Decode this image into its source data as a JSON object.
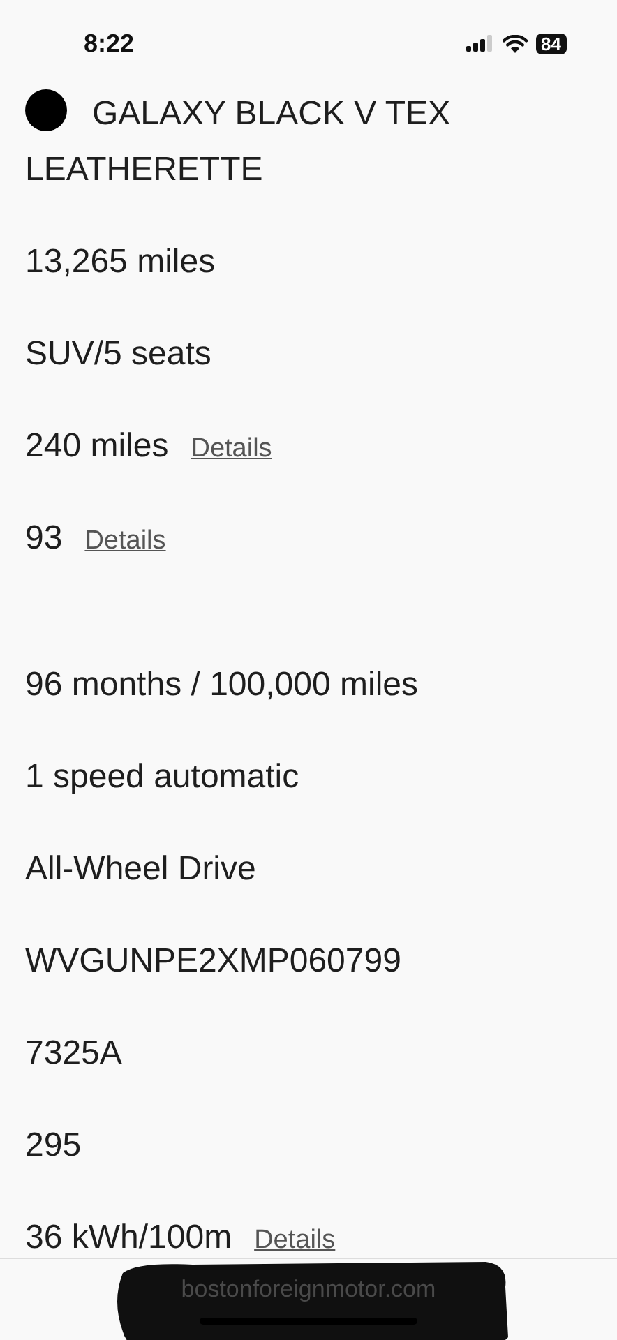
{
  "status_bar": {
    "time": "8:22",
    "battery": "84"
  },
  "specs": [
    {
      "kind": "color",
      "color": "#000000",
      "text": "GALAXY BLACK V TEX LEATHERETTE"
    },
    {
      "kind": "text",
      "text": "13,265 miles"
    },
    {
      "kind": "text",
      "text": "SUV/5 seats"
    },
    {
      "kind": "link",
      "text": "240 miles",
      "link": "Details"
    },
    {
      "kind": "link",
      "text": "93",
      "link": "Details"
    },
    {
      "kind": "spacer"
    },
    {
      "kind": "text",
      "text": "96 months / 100,000 miles"
    },
    {
      "kind": "text",
      "text": "1 speed automatic"
    },
    {
      "kind": "text",
      "text": "All-Wheel Drive"
    },
    {
      "kind": "text",
      "text": "WVGUNPE2XMP060799"
    },
    {
      "kind": "text",
      "text": "7325A"
    },
    {
      "kind": "text",
      "text": "295"
    },
    {
      "kind": "link",
      "text": "36 kWh/100m",
      "link": "Details"
    }
  ],
  "browser_bar": {
    "url": "bostonforeignmotor.com"
  }
}
